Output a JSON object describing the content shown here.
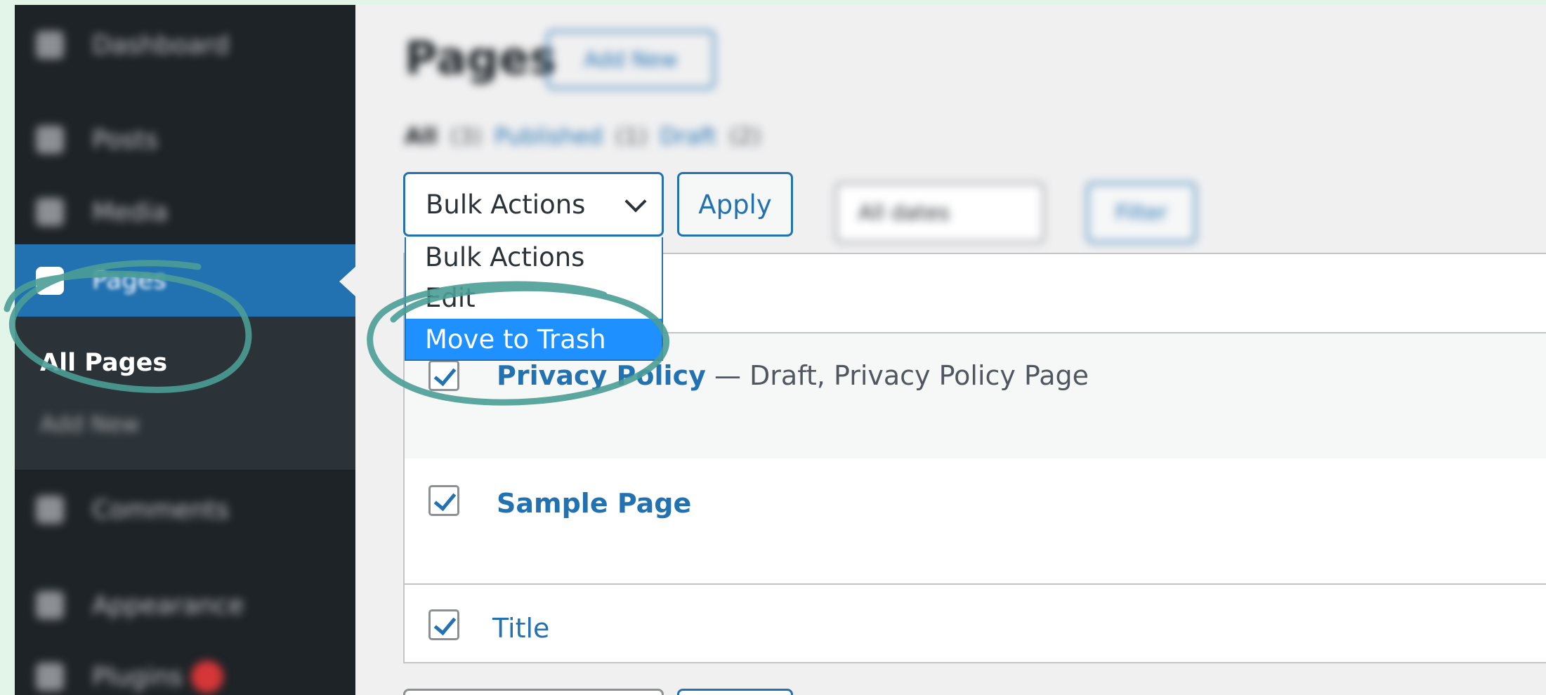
{
  "sidebar": {
    "items": [
      {
        "label": "Dashboard",
        "icon": "dashboard-icon"
      },
      {
        "label": "Posts",
        "icon": "pin-icon"
      },
      {
        "label": "Media",
        "icon": "media-icon"
      },
      {
        "label": "Pages",
        "icon": "page-icon"
      },
      {
        "label": "Comments",
        "icon": "comment-icon"
      },
      {
        "label": "Appearance",
        "icon": "brush-icon"
      },
      {
        "label": "Plugins",
        "icon": "plug-icon"
      }
    ],
    "submenu": {
      "all_pages": "All Pages",
      "add_new": "Add New"
    }
  },
  "header": {
    "title": "Pages",
    "add_new": "Add New"
  },
  "views": {
    "all": "All",
    "all_count": "(3)",
    "published": "Published",
    "published_count": "(1)",
    "drafts": "Draft",
    "drafts_count": "(2)"
  },
  "bulk_actions": {
    "selected": "Bulk Actions",
    "options": [
      "Bulk Actions",
      "Edit",
      "Move to Trash"
    ],
    "highlighted": "Move to Trash",
    "apply": "Apply"
  },
  "filters": {
    "date": "All dates",
    "filter": "Filter"
  },
  "table": {
    "rows": [
      {
        "title": "Privacy Policy",
        "state": " — Draft, Privacy Policy Page",
        "checked": true
      },
      {
        "title": "Sample Page",
        "state": "",
        "checked": true
      }
    ],
    "footer_column": "Title"
  },
  "colors": {
    "sidebar": "#1d2327",
    "accent": "#2271b1",
    "highlight": "#1e90ff",
    "annotation": "#4a9d96",
    "backdrop": "#e3f4e8"
  }
}
